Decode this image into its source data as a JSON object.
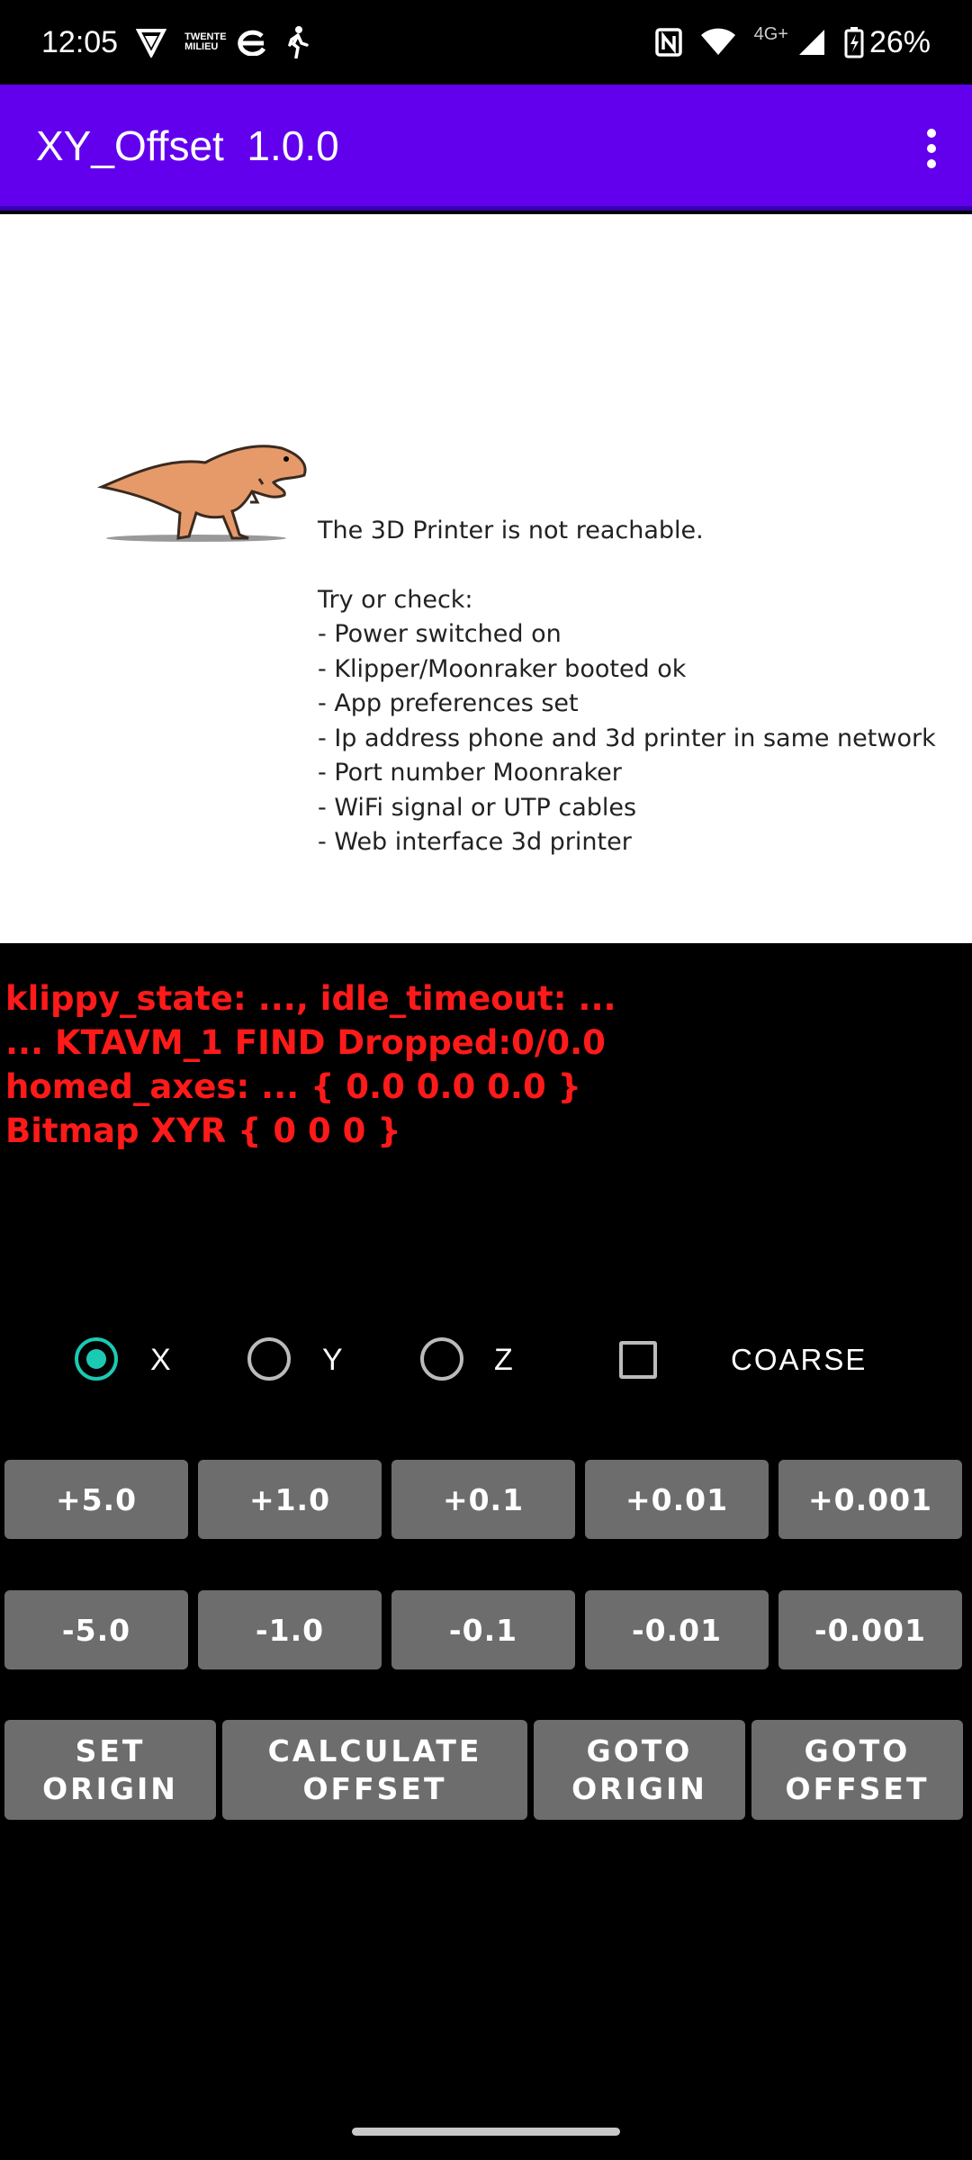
{
  "status_bar": {
    "time": "12:05",
    "brand_text": "TWENTE MILIEU",
    "network": "4G+",
    "battery": "26%"
  },
  "app_bar": {
    "title": "XY_Offset  1.0.0",
    "menu_icon": "more-vert-icon"
  },
  "message": {
    "headline": "The 3D Printer is not reachable.",
    "intro": "Try or check:",
    "checks": [
      "- Power switched on",
      "- Klipper/Moonraker booted ok",
      "- App preferences set",
      "- Ip address phone and 3d printer in same network",
      "- Port number Moonraker",
      "- WiFi signal or UTP cables",
      "- Web interface 3d printer"
    ]
  },
  "state_lines": [
    "klippy_state: ..., idle_timeout: ...",
    "... KTAVM_1 FIND Dropped:0/0.0",
    "homed_axes: ... { 0.0 0.0 0.0 }",
    "Bitmap XYR { 0 0 0 }"
  ],
  "axes": {
    "options": [
      "X",
      "Y",
      "Z"
    ],
    "selected": "X",
    "coarse_label": "COARSE",
    "coarse_checked": false
  },
  "step_buttons": {
    "plus": [
      "+5.0",
      "+1.0",
      "+0.1",
      "+0.01",
      "+0.001"
    ],
    "minus": [
      "-5.0",
      "-1.0",
      "-0.1",
      "-0.01",
      "-0.001"
    ]
  },
  "action_buttons": {
    "set_origin": "SET\nORIGIN",
    "calculate_offset": "CALCULATE\nOFFSET",
    "goto_origin": "GOTO\nORIGIN",
    "goto_offset": "GOTO\nOFFSET"
  },
  "colors": {
    "app_bar": "#6200ee",
    "accent": "#1cc9b3",
    "state_text": "#ff1a1a",
    "button": "#6d6d6d"
  }
}
